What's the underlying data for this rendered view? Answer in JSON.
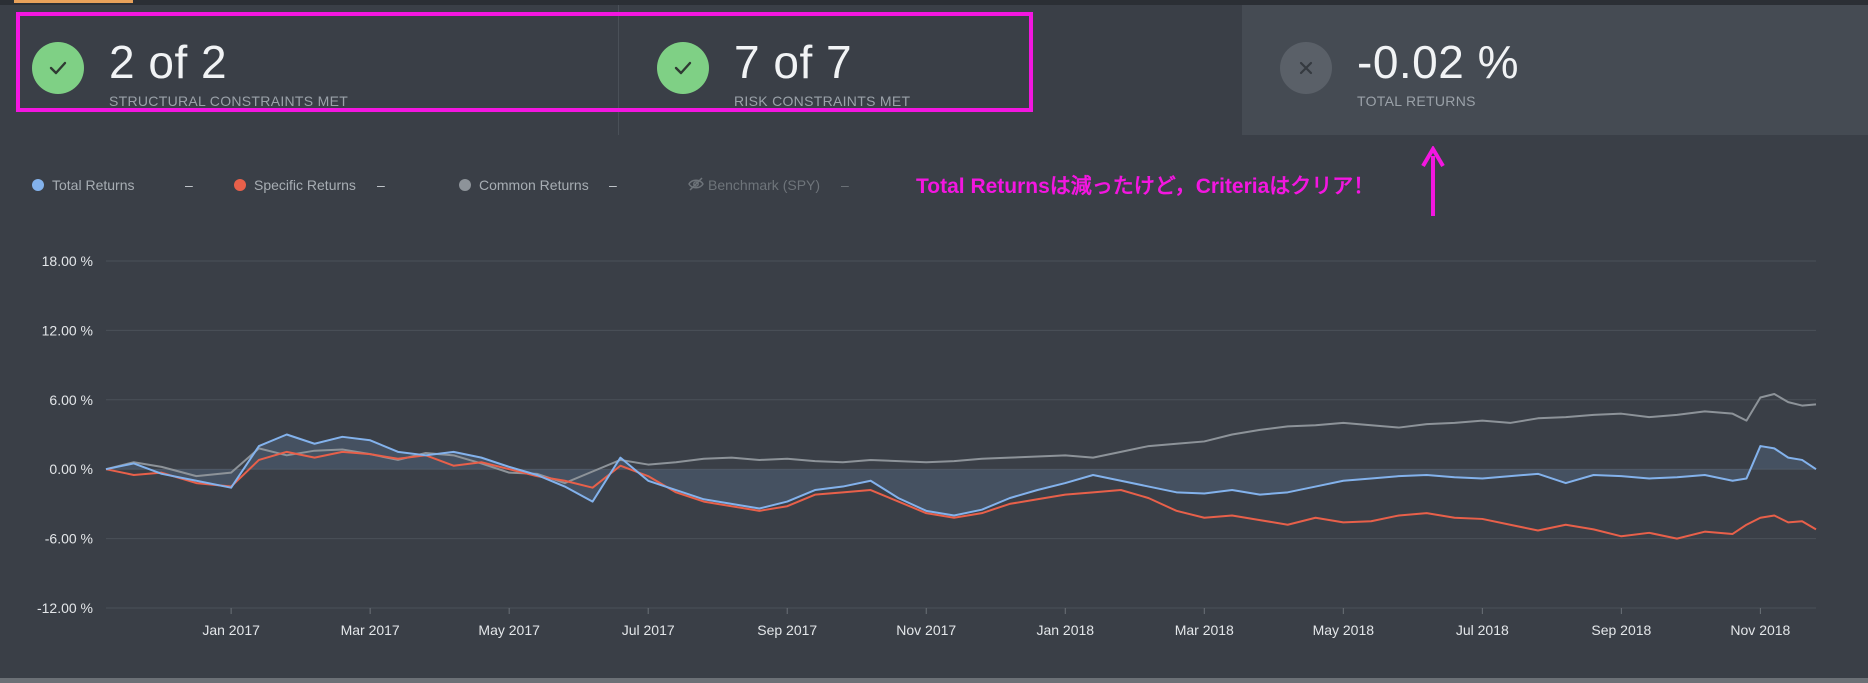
{
  "metrics": [
    {
      "value": "2 of 2",
      "label": "STRUCTURAL CONSTRAINTS MET",
      "status": "ok",
      "icon": "check-icon"
    },
    {
      "value": "7 of 7",
      "label": "RISK CONSTRAINTS MET",
      "status": "ok",
      "icon": "check-icon"
    },
    {
      "value": "-0.02 %",
      "label": "TOTAL RETURNS",
      "status": "neutral",
      "icon": "close-icon"
    }
  ],
  "legend": [
    {
      "name": "Total Returns",
      "value": "–",
      "color": "#83b2ec",
      "enabled": true
    },
    {
      "name": "Specific Returns",
      "value": "–",
      "color": "#e8604a",
      "enabled": true
    },
    {
      "name": "Common Returns",
      "value": "–",
      "color": "#8d9399",
      "enabled": true
    },
    {
      "name": "Benchmark (SPY)",
      "value": "–",
      "color": "#6e747a",
      "enabled": false
    }
  ],
  "annotation": {
    "text": "Total Returnsは減ったけど，Criteriaはクリア！",
    "color": "#f316e0"
  },
  "chart_data": {
    "type": "line",
    "y_ticks": [
      "18.00 %",
      "12.00 %",
      "6.00 %",
      "0.00 %",
      "-6.00 %",
      "-12.00 %"
    ],
    "ylim": [
      -12,
      18
    ],
    "x_ticks": [
      "Jan 2017",
      "Mar 2017",
      "May 2017",
      "Jul 2017",
      "Sep 2017",
      "Nov 2017",
      "Jan 2018",
      "Mar 2018",
      "May 2018",
      "Jul 2018",
      "Sep 2018",
      "Nov 2018"
    ],
    "x_tick_positions": [
      2.0,
      4.0,
      6.0,
      8.0,
      10.0,
      12.0,
      14.0,
      16.0,
      18.0,
      20.0,
      22.0,
      24.0
    ],
    "x_range": [
      0.2,
      24.8
    ],
    "grid": true,
    "series": [
      {
        "name": "Common Returns",
        "color": "#8d9399",
        "x": [
          0.2,
          0.6,
          1.0,
          1.5,
          2.0,
          2.4,
          2.8,
          3.2,
          3.6,
          4.0,
          4.4,
          4.8,
          5.2,
          5.6,
          6.0,
          6.4,
          6.8,
          7.2,
          7.6,
          8.0,
          8.4,
          8.8,
          9.2,
          9.6,
          10.0,
          10.4,
          10.8,
          11.2,
          11.6,
          12.0,
          12.4,
          12.8,
          13.2,
          13.6,
          14.0,
          14.4,
          14.8,
          15.2,
          15.6,
          16.0,
          16.4,
          16.8,
          17.2,
          17.6,
          18.0,
          18.4,
          18.8,
          19.2,
          19.6,
          20.0,
          20.4,
          20.8,
          21.2,
          21.6,
          22.0,
          22.4,
          22.8,
          23.2,
          23.6,
          23.8,
          24.0,
          24.2,
          24.4,
          24.6,
          24.8
        ],
        "y": [
          0.0,
          0.6,
          0.2,
          -0.6,
          -0.3,
          1.8,
          1.2,
          1.6,
          1.7,
          1.3,
          0.8,
          1.4,
          1.2,
          0.5,
          -0.3,
          -0.4,
          -1.2,
          -0.2,
          0.8,
          0.4,
          0.6,
          0.9,
          1.0,
          0.8,
          0.9,
          0.7,
          0.6,
          0.8,
          0.7,
          0.6,
          0.7,
          0.9,
          1.0,
          1.1,
          1.2,
          1.0,
          1.5,
          2.0,
          2.2,
          2.4,
          3.0,
          3.4,
          3.7,
          3.8,
          4.0,
          3.8,
          3.6,
          3.9,
          4.0,
          4.2,
          4.0,
          4.4,
          4.5,
          4.7,
          4.8,
          4.5,
          4.7,
          5.0,
          4.8,
          4.2,
          6.2,
          6.5,
          5.8,
          5.5,
          5.6
        ]
      },
      {
        "name": "Specific Returns",
        "color": "#e8604a",
        "x": [
          0.2,
          0.6,
          1.0,
          1.5,
          2.0,
          2.4,
          2.8,
          3.2,
          3.6,
          4.0,
          4.4,
          4.8,
          5.2,
          5.6,
          6.0,
          6.4,
          6.8,
          7.2,
          7.6,
          8.0,
          8.4,
          8.8,
          9.2,
          9.6,
          10.0,
          10.4,
          10.8,
          11.2,
          11.6,
          12.0,
          12.4,
          12.8,
          13.2,
          13.6,
          14.0,
          14.4,
          14.8,
          15.2,
          15.6,
          16.0,
          16.4,
          16.8,
          17.2,
          17.6,
          18.0,
          18.4,
          18.8,
          19.2,
          19.6,
          20.0,
          20.4,
          20.8,
          21.2,
          21.6,
          22.0,
          22.4,
          22.8,
          23.2,
          23.6,
          23.8,
          24.0,
          24.2,
          24.4,
          24.6,
          24.8
        ],
        "y": [
          0.0,
          -0.5,
          -0.3,
          -1.2,
          -1.5,
          0.8,
          1.5,
          1.0,
          1.5,
          1.3,
          0.9,
          1.2,
          0.3,
          0.6,
          0.0,
          -0.6,
          -1.0,
          -1.6,
          0.3,
          -0.6,
          -2.0,
          -2.8,
          -3.2,
          -3.6,
          -3.2,
          -2.2,
          -2.0,
          -1.8,
          -2.8,
          -3.8,
          -4.2,
          -3.8,
          -3.0,
          -2.6,
          -2.2,
          -2.0,
          -1.8,
          -2.5,
          -3.6,
          -4.2,
          -4.0,
          -4.4,
          -4.8,
          -4.2,
          -4.6,
          -4.5,
          -4.0,
          -3.8,
          -4.2,
          -4.3,
          -4.8,
          -5.3,
          -4.8,
          -5.2,
          -5.8,
          -5.5,
          -6.0,
          -5.4,
          -5.6,
          -4.8,
          -4.2,
          -4.0,
          -4.6,
          -4.5,
          -5.2
        ]
      },
      {
        "name": "Total Returns",
        "color": "#83b2ec",
        "x": [
          0.2,
          0.6,
          1.0,
          1.5,
          2.0,
          2.4,
          2.8,
          3.2,
          3.6,
          4.0,
          4.4,
          4.8,
          5.2,
          5.6,
          6.0,
          6.4,
          6.8,
          7.2,
          7.6,
          8.0,
          8.4,
          8.8,
          9.2,
          9.6,
          10.0,
          10.4,
          10.8,
          11.2,
          11.6,
          12.0,
          12.4,
          12.8,
          13.2,
          13.6,
          14.0,
          14.4,
          14.8,
          15.2,
          15.6,
          16.0,
          16.4,
          16.8,
          17.2,
          17.6,
          18.0,
          18.4,
          18.8,
          19.2,
          19.6,
          20.0,
          20.4,
          20.8,
          21.2,
          21.6,
          22.0,
          22.4,
          22.8,
          23.2,
          23.6,
          23.8,
          24.0,
          24.2,
          24.4,
          24.6,
          24.8
        ],
        "y": [
          0.0,
          0.5,
          -0.4,
          -1.0,
          -1.6,
          2.0,
          3.0,
          2.2,
          2.8,
          2.5,
          1.5,
          1.2,
          1.5,
          1.0,
          0.2,
          -0.5,
          -1.5,
          -2.8,
          1.0,
          -1.0,
          -1.8,
          -2.6,
          -3.0,
          -3.4,
          -2.8,
          -1.8,
          -1.5,
          -1.0,
          -2.5,
          -3.6,
          -4.0,
          -3.5,
          -2.5,
          -1.8,
          -1.2,
          -0.5,
          -1.0,
          -1.5,
          -2.0,
          -2.1,
          -1.8,
          -2.2,
          -2.0,
          -1.5,
          -1.0,
          -0.8,
          -0.6,
          -0.5,
          -0.7,
          -0.8,
          -0.6,
          -0.4,
          -1.2,
          -0.5,
          -0.6,
          -0.8,
          -0.7,
          -0.5,
          -1.0,
          -0.8,
          2.0,
          1.8,
          1.0,
          0.8,
          0.0
        ]
      }
    ]
  }
}
